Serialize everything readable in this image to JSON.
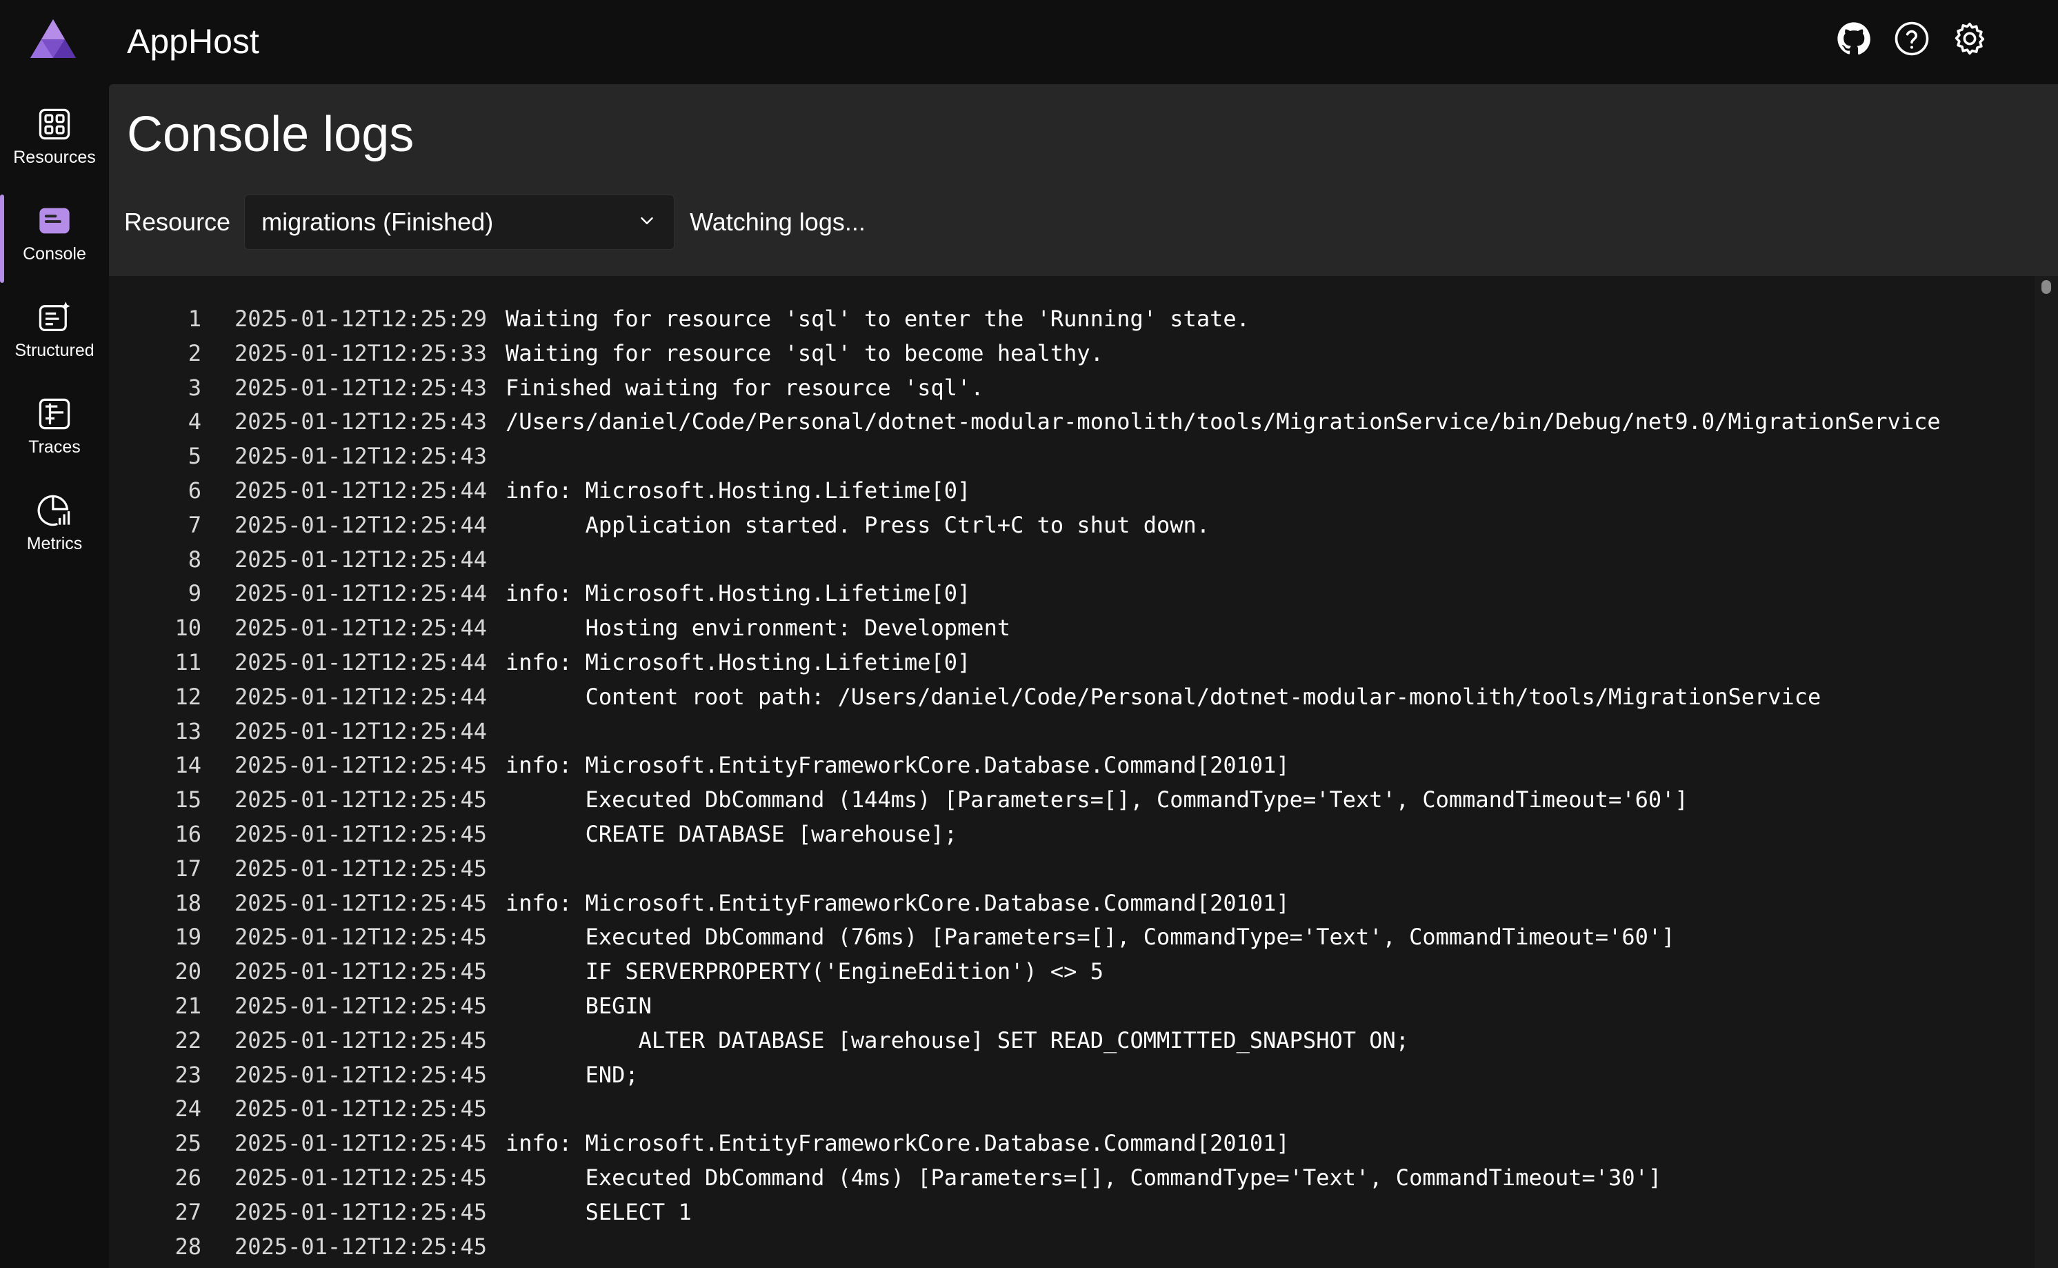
{
  "app": {
    "title": "AppHost",
    "accent_color": "#b58ce8"
  },
  "top_icons": [
    {
      "name": "github-icon"
    },
    {
      "name": "help-icon"
    },
    {
      "name": "settings-icon"
    }
  ],
  "sidebar": {
    "items": [
      {
        "label": "Resources",
        "icon": "grid-icon",
        "active": false
      },
      {
        "label": "Console",
        "icon": "console-icon",
        "active": true
      },
      {
        "label": "Structured",
        "icon": "structured-logs-icon",
        "active": false
      },
      {
        "label": "Traces",
        "icon": "traces-icon",
        "active": false
      },
      {
        "label": "Metrics",
        "icon": "metrics-icon",
        "active": false
      }
    ]
  },
  "page": {
    "title": "Console logs",
    "resource_label": "Resource",
    "resource_selected": "migrations (Finished)",
    "status": "Watching logs..."
  },
  "logs": [
    {
      "n": "1",
      "ts": "2025-01-12T12:25:29",
      "msg": "Waiting for resource 'sql' to enter the 'Running' state."
    },
    {
      "n": "2",
      "ts": "2025-01-12T12:25:33",
      "msg": "Waiting for resource 'sql' to become healthy."
    },
    {
      "n": "3",
      "ts": "2025-01-12T12:25:43",
      "msg": "Finished waiting for resource 'sql'."
    },
    {
      "n": "4",
      "ts": "2025-01-12T12:25:43",
      "msg": "/Users/daniel/Code/Personal/dotnet-modular-monolith/tools/MigrationService/bin/Debug/net9.0/MigrationService"
    },
    {
      "n": "5",
      "ts": "2025-01-12T12:25:43",
      "msg": ""
    },
    {
      "n": "6",
      "ts": "2025-01-12T12:25:44",
      "msg": "info: Microsoft.Hosting.Lifetime[0]"
    },
    {
      "n": "7",
      "ts": "2025-01-12T12:25:44",
      "msg": "      Application started. Press Ctrl+C to shut down."
    },
    {
      "n": "8",
      "ts": "2025-01-12T12:25:44",
      "msg": ""
    },
    {
      "n": "9",
      "ts": "2025-01-12T12:25:44",
      "msg": "info: Microsoft.Hosting.Lifetime[0]"
    },
    {
      "n": "10",
      "ts": "2025-01-12T12:25:44",
      "msg": "      Hosting environment: Development"
    },
    {
      "n": "11",
      "ts": "2025-01-12T12:25:44",
      "msg": "info: Microsoft.Hosting.Lifetime[0]"
    },
    {
      "n": "12",
      "ts": "2025-01-12T12:25:44",
      "msg": "      Content root path: /Users/daniel/Code/Personal/dotnet-modular-monolith/tools/MigrationService"
    },
    {
      "n": "13",
      "ts": "2025-01-12T12:25:44",
      "msg": ""
    },
    {
      "n": "14",
      "ts": "2025-01-12T12:25:45",
      "msg": "info: Microsoft.EntityFrameworkCore.Database.Command[20101]"
    },
    {
      "n": "15",
      "ts": "2025-01-12T12:25:45",
      "msg": "      Executed DbCommand (144ms) [Parameters=[], CommandType='Text', CommandTimeout='60']"
    },
    {
      "n": "16",
      "ts": "2025-01-12T12:25:45",
      "msg": "      CREATE DATABASE [warehouse];"
    },
    {
      "n": "17",
      "ts": "2025-01-12T12:25:45",
      "msg": ""
    },
    {
      "n": "18",
      "ts": "2025-01-12T12:25:45",
      "msg": "info: Microsoft.EntityFrameworkCore.Database.Command[20101]"
    },
    {
      "n": "19",
      "ts": "2025-01-12T12:25:45",
      "msg": "      Executed DbCommand (76ms) [Parameters=[], CommandType='Text', CommandTimeout='60']"
    },
    {
      "n": "20",
      "ts": "2025-01-12T12:25:45",
      "msg": "      IF SERVERPROPERTY('EngineEdition') <> 5"
    },
    {
      "n": "21",
      "ts": "2025-01-12T12:25:45",
      "msg": "      BEGIN"
    },
    {
      "n": "22",
      "ts": "2025-01-12T12:25:45",
      "msg": "          ALTER DATABASE [warehouse] SET READ_COMMITTED_SNAPSHOT ON;"
    },
    {
      "n": "23",
      "ts": "2025-01-12T12:25:45",
      "msg": "      END;"
    },
    {
      "n": "24",
      "ts": "2025-01-12T12:25:45",
      "msg": ""
    },
    {
      "n": "25",
      "ts": "2025-01-12T12:25:45",
      "msg": "info: Microsoft.EntityFrameworkCore.Database.Command[20101]"
    },
    {
      "n": "26",
      "ts": "2025-01-12T12:25:45",
      "msg": "      Executed DbCommand (4ms) [Parameters=[], CommandType='Text', CommandTimeout='30']"
    },
    {
      "n": "27",
      "ts": "2025-01-12T12:25:45",
      "msg": "      SELECT 1"
    },
    {
      "n": "28",
      "ts": "2025-01-12T12:25:45",
      "msg": ""
    }
  ]
}
